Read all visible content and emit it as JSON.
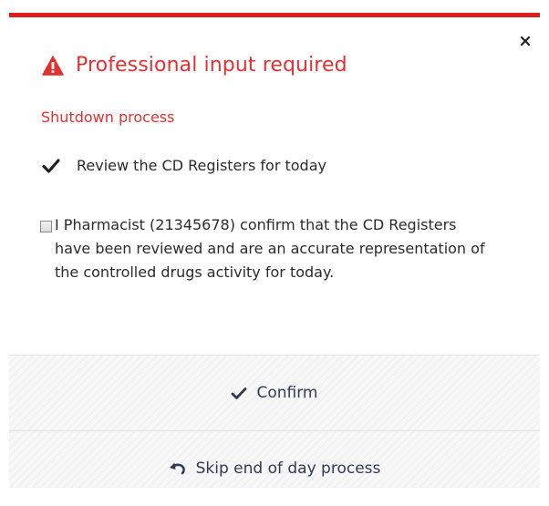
{
  "dialog": {
    "title": "Professional input required",
    "section_title": "Shutdown process",
    "close_icon": "close-icon",
    "warning_icon": "warning-triangle-icon"
  },
  "task": {
    "label": "Review the CD Registers for today",
    "status_icon": "checkmark-icon",
    "completed": true
  },
  "confirmation": {
    "checked": false,
    "text": "I  Pharmacist (21345678) confirm that the CD Registers have been reviewed and are an accurate representation of the controlled drugs activity for today."
  },
  "actions": {
    "confirm_label": "Confirm",
    "skip_label": "Skip end of day process"
  },
  "colors": {
    "accent_red": "#e33131",
    "top_bar_red": "#dc1e1e",
    "action_text": "#2d3b57"
  }
}
